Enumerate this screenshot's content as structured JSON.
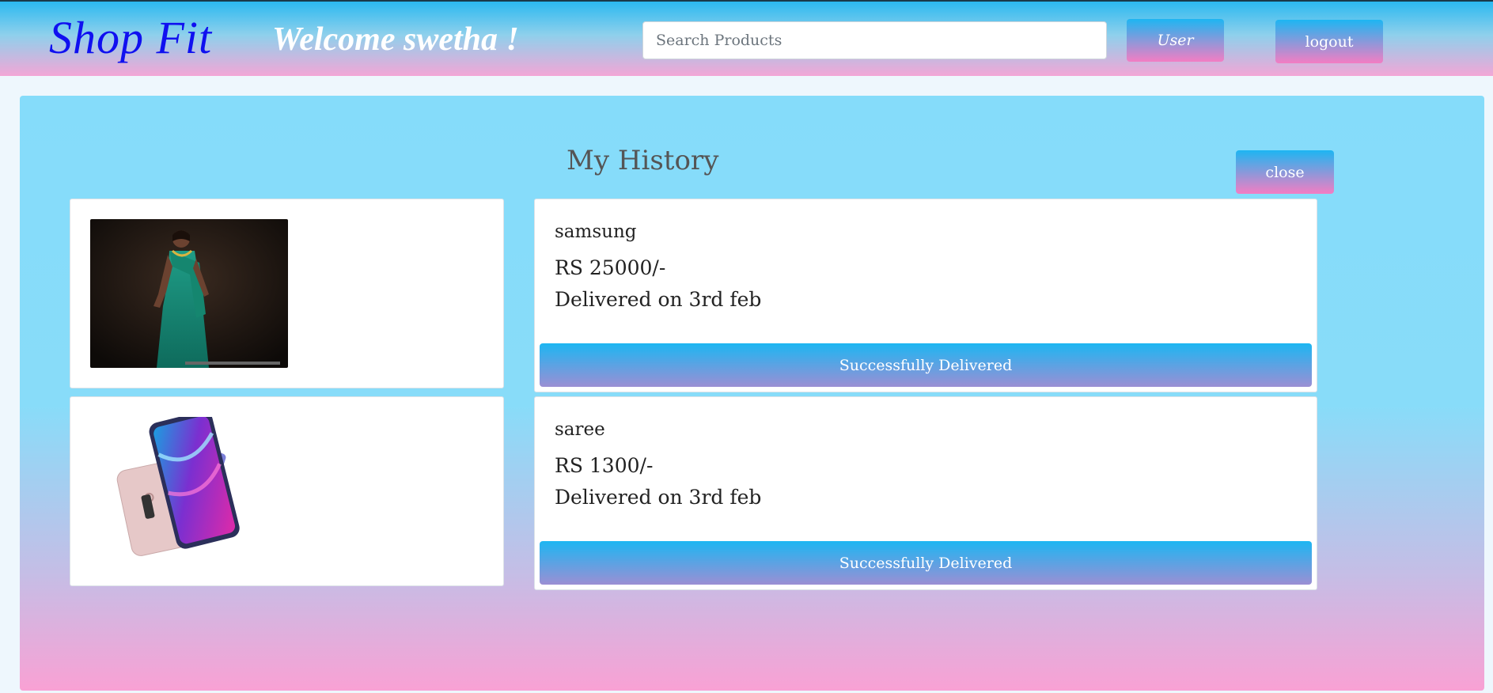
{
  "header": {
    "brand": "Shop Fit",
    "welcome": "Welcome swetha !",
    "search_placeholder": "Search Products",
    "user_label": "User",
    "logout_label": "logout"
  },
  "history": {
    "title": "My History",
    "close_label": "close",
    "orders": [
      {
        "name": "samsung",
        "price": "RS 25000/-",
        "delivered": "Delivered on 3rd feb",
        "status": "Successfully Delivered",
        "image": "saree-photo"
      },
      {
        "name": "saree",
        "price": "RS 1300/-",
        "delivered": "Delivered on 3rd feb",
        "status": "Successfully Delivered",
        "image": "smartphone-photo"
      }
    ]
  },
  "colors": {
    "brand": "#1010f0",
    "gradient_blue": "#1db6f2",
    "gradient_pink": "#f37dc3",
    "panel_blue": "#85dcfa"
  }
}
